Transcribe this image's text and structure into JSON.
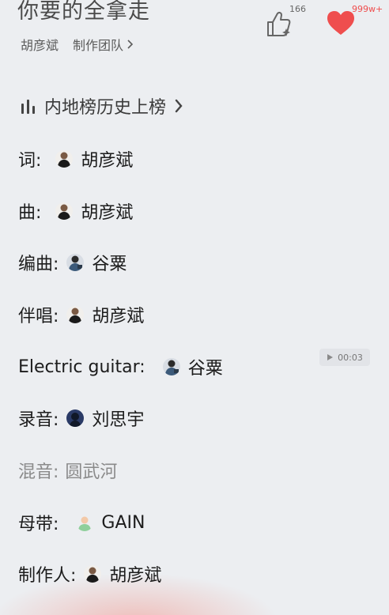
{
  "header": {
    "song_title": "你要的全拿走",
    "artist": "胡彦斌",
    "team_link": "制作团队",
    "like_count": "166",
    "favorite_count": "999w+"
  },
  "chart_link": {
    "label": "内地榜历史上榜"
  },
  "credits": [
    {
      "role": "词:",
      "name": "胡彦斌",
      "avatar": "man-black-shirt"
    },
    {
      "role": "曲:",
      "name": "胡彦斌",
      "avatar": "man-black-shirt"
    },
    {
      "role": "编曲:",
      "name": "谷粟",
      "avatar": "man-blue-shirt"
    },
    {
      "role": "伴唱:",
      "name": "胡彦斌",
      "avatar": "man-black-shirt"
    },
    {
      "role": "Electric guitar:",
      "name": "谷粟",
      "avatar": "man-blue-shirt"
    },
    {
      "role": "录音:",
      "name": "刘思宇",
      "avatar": "dark-blue-circle"
    },
    {
      "role": "混音:",
      "name": "圆武河",
      "avatar": ""
    },
    {
      "role": "母带:",
      "name": "GAIN",
      "avatar": "default-user-green"
    },
    {
      "role": "制作人:",
      "name": "胡彦斌",
      "avatar": "man-black-shirt"
    }
  ],
  "video_chip": {
    "time": "00:03"
  },
  "colors": {
    "heart": "#ef4e4e",
    "background": "#eceef1"
  }
}
